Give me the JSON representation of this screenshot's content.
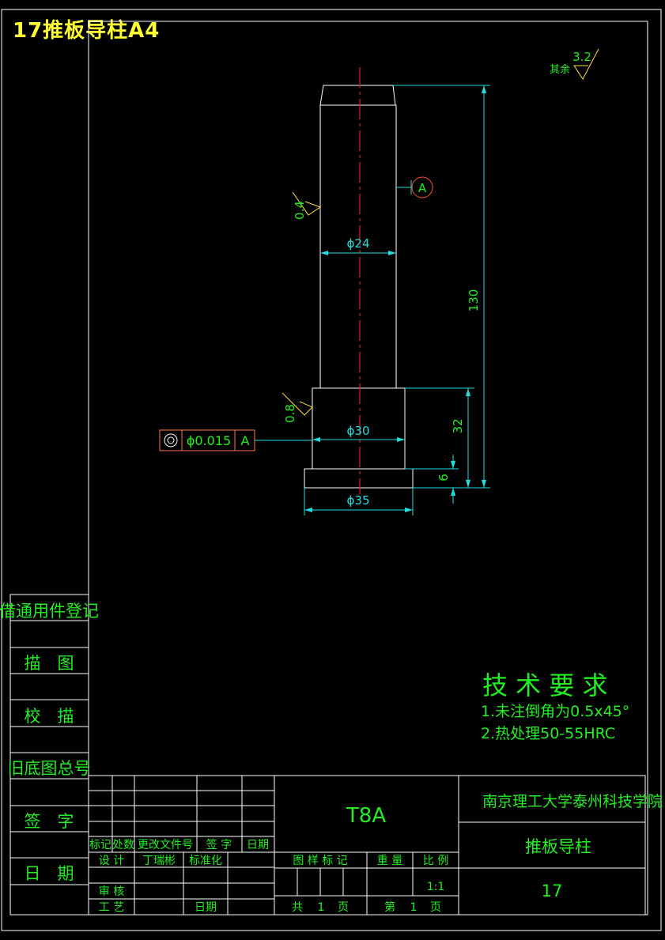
{
  "sheet_title": "17推板导柱A4",
  "roughness": {
    "other_label": "其余",
    "other_value": "3.2",
    "shaft_value": "0.4",
    "collar_value": "0.8"
  },
  "datum": {
    "letter": "A"
  },
  "tolerance": {
    "symbol": "◎",
    "value": "ϕ0.015",
    "datum": "A"
  },
  "dimensions": {
    "d24": "ϕ24",
    "d30": "ϕ30",
    "d35": "ϕ35",
    "len130": "130",
    "len32": "32",
    "len6": "6"
  },
  "tech_req": {
    "title": "技 术 要 求",
    "items": [
      "1.未注倒角为0.5x45°",
      "2.热处理50-55HRC"
    ]
  },
  "side_stamp": {
    "items": [
      "借通用件登记",
      "描　图",
      "校　描",
      "旧底图总号",
      "签　字",
      "日　期"
    ]
  },
  "title_block": {
    "material": "T8A",
    "school": "南京理工大学泰州科技学院",
    "part_name": "推板导柱",
    "drawing_no": "17",
    "rev_headers": [
      "标记",
      "处数",
      "更改文件号",
      "签  字",
      "日期"
    ],
    "design": "设 计",
    "designer": "丁瑞彬",
    "standardize": "标准化",
    "review": "审 核",
    "process": "工 艺",
    "date": "日期",
    "stage_mark": "图 样 标 记",
    "weight": "重 量",
    "scale_label": "比 例",
    "scale_value": "1:1",
    "total_label": "共",
    "total_pages": "1",
    "page_unit": "页",
    "page_label": "第",
    "page_num": "1"
  }
}
